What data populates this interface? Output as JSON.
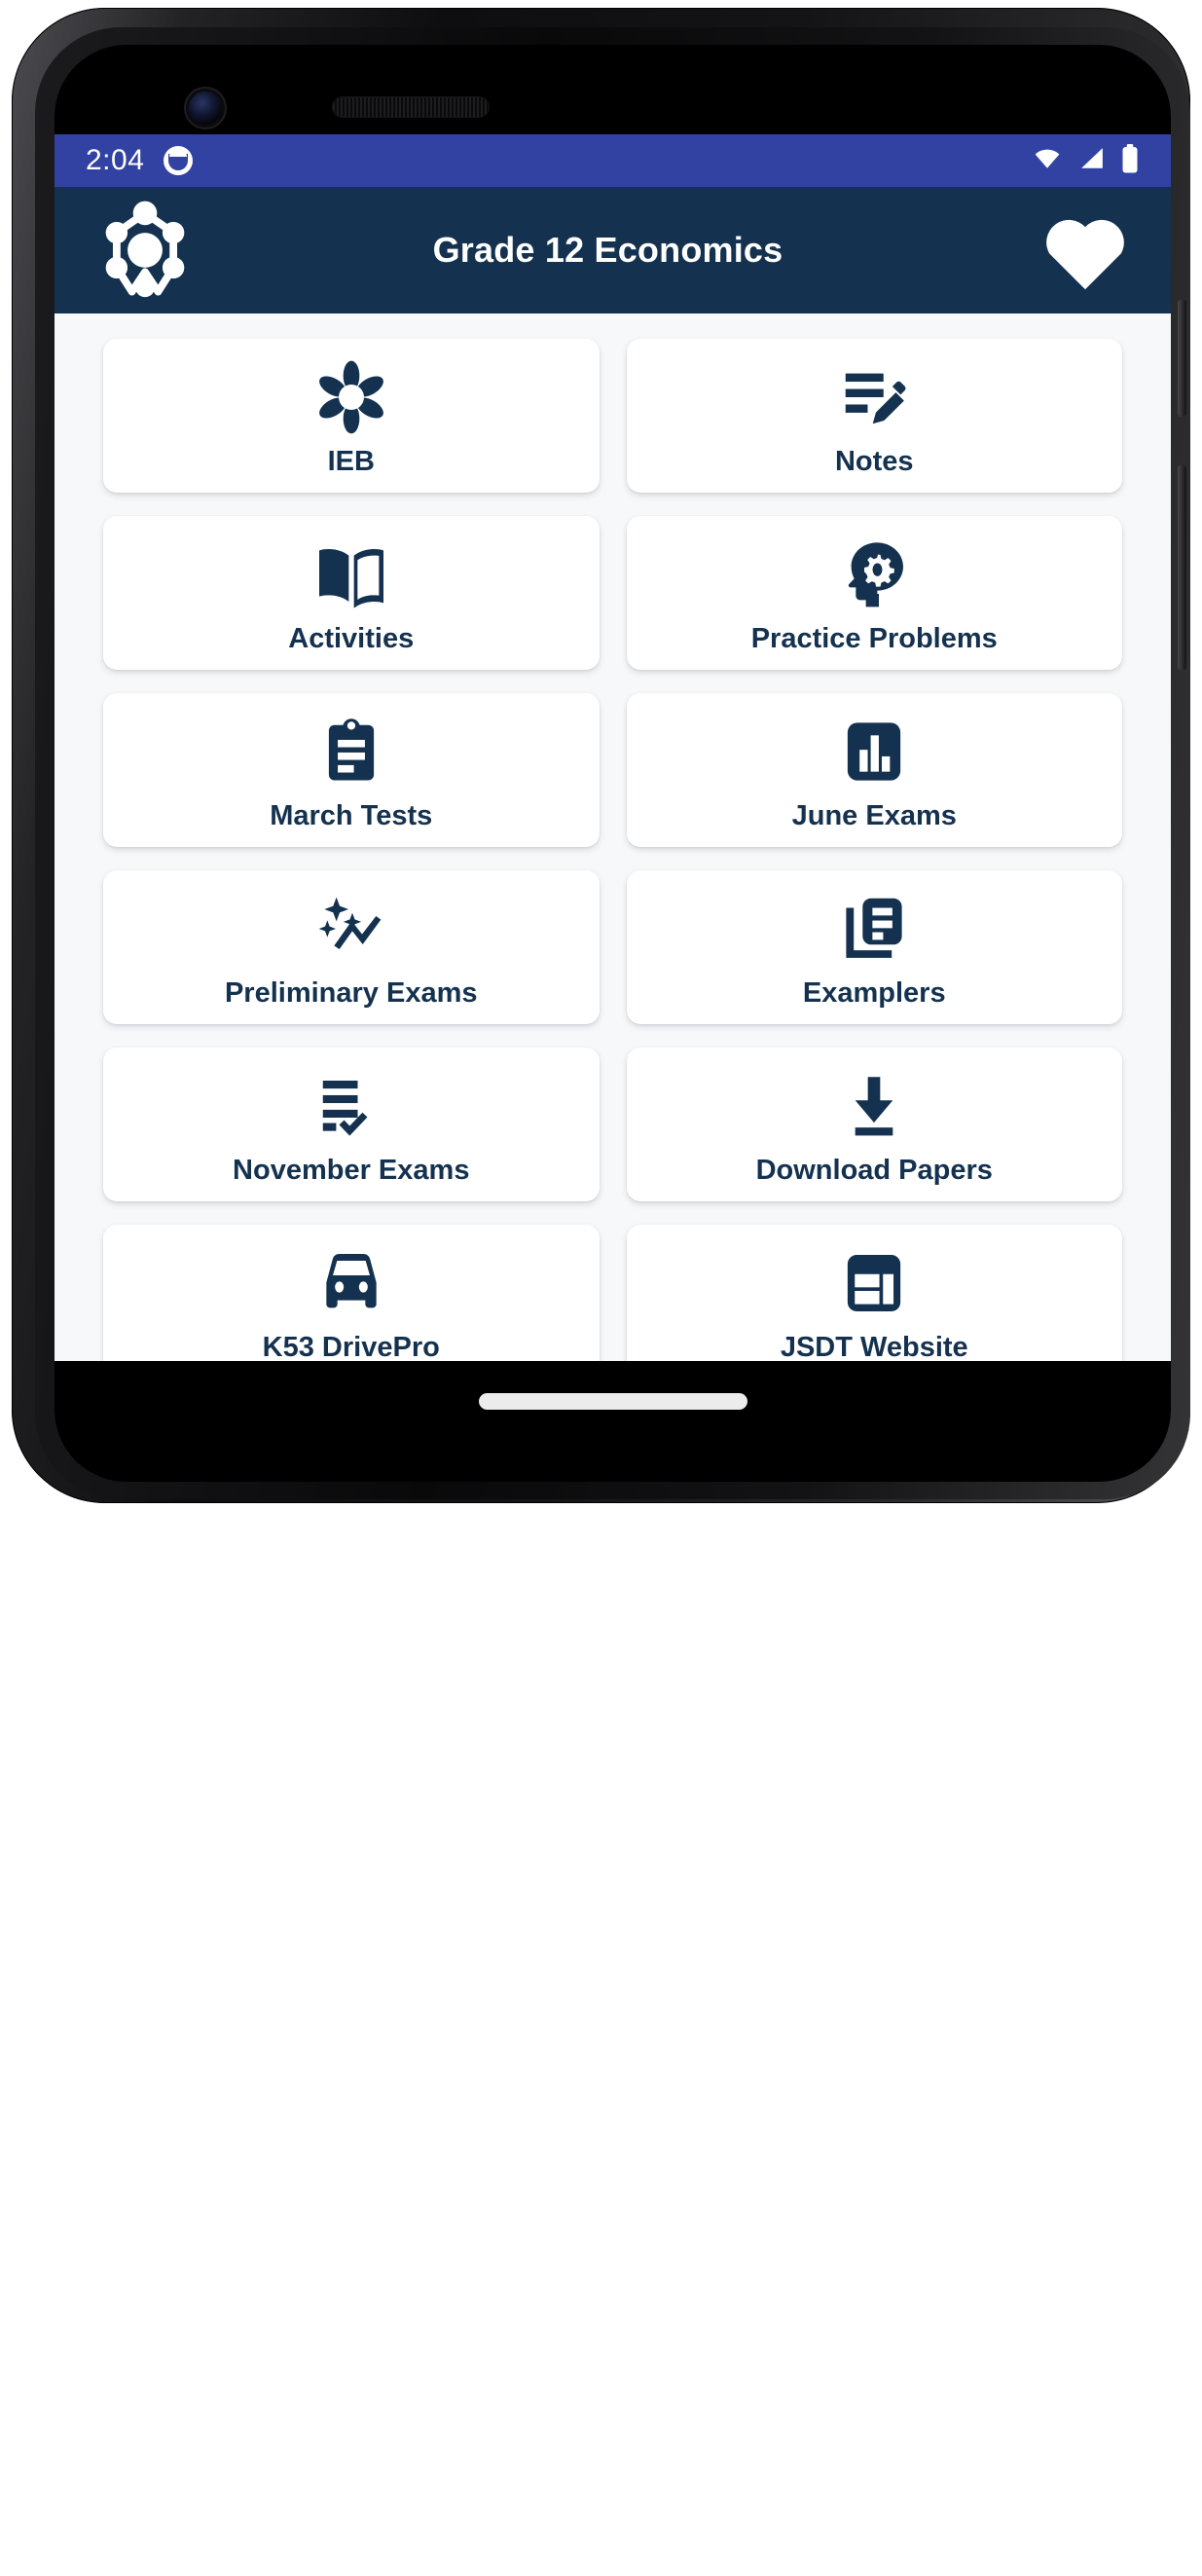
{
  "colors": {
    "status_bar": "#3142a3",
    "app_bar": "#14324f",
    "page_bg": "#f7f8fa",
    "card_bg": "#ffffff",
    "icon": "#14324f",
    "text": "#14324f"
  },
  "status_bar": {
    "clock": "2:04",
    "notification_icon": "app-notification-icon",
    "wifi_icon": "wifi-icon",
    "signal_icon": "cellular-signal-icon",
    "battery_icon": "battery-full-icon"
  },
  "app_bar": {
    "logo_icon": "ferris-wheel-molecule-logo",
    "title": "Grade 12 Economics",
    "favorite_icon": "heart-filled-icon"
  },
  "grid": {
    "items": [
      {
        "label": "IEB",
        "icon": "flower-icon"
      },
      {
        "label": "Notes",
        "icon": "note-edit-icon"
      },
      {
        "label": "Activities",
        "icon": "open-book-icon"
      },
      {
        "label": "Practice Problems",
        "icon": "head-gear-psychology-icon"
      },
      {
        "label": "March Tests",
        "icon": "clipboard-list-icon"
      },
      {
        "label": "June Exams",
        "icon": "bar-chart-icon"
      },
      {
        "label": "Preliminary Exams",
        "icon": "auto-graph-sparkle-icon"
      },
      {
        "label": "Examplers",
        "icon": "library-documents-icon"
      },
      {
        "label": "November Exams",
        "icon": "playlist-check-icon"
      },
      {
        "label": "Download Papers",
        "icon": "download-icon"
      },
      {
        "label": "K53 DrivePro",
        "icon": "car-front-icon"
      },
      {
        "label": "JSDT Website",
        "icon": "web-layout-icon"
      }
    ]
  },
  "system": {
    "gesture_bar": "home-gesture-bar"
  }
}
